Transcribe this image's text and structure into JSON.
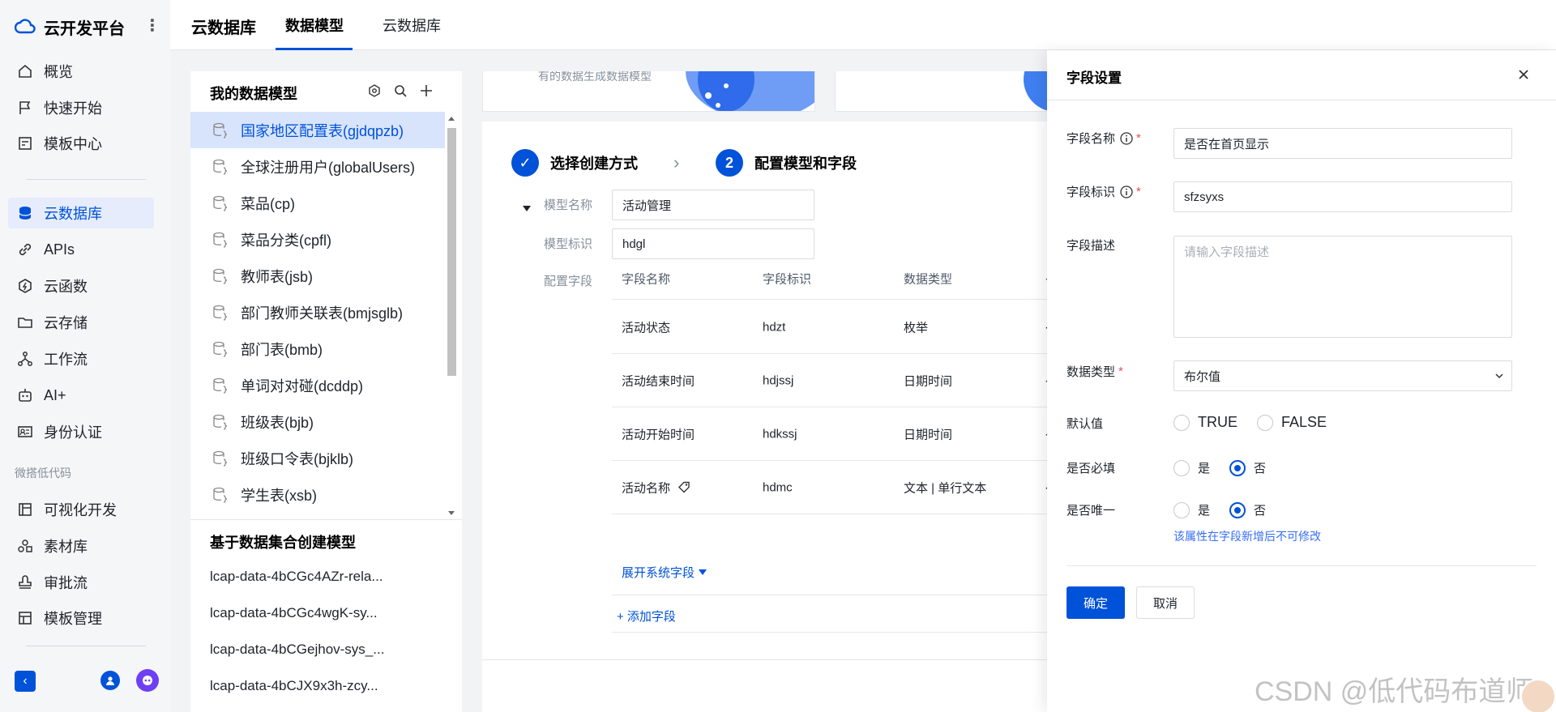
{
  "brand": {
    "title": "云开发平台",
    "more": "⋮"
  },
  "nav": {
    "items": [
      {
        "label": "概览",
        "icon": "home-icon"
      },
      {
        "label": "快速开始",
        "icon": "flag-icon"
      },
      {
        "label": "模板中心",
        "icon": "template-icon"
      },
      {
        "label": "云数据库",
        "icon": "database-icon",
        "active": true
      },
      {
        "label": "APIs",
        "icon": "link-icon"
      },
      {
        "label": "云函数",
        "icon": "function-icon"
      },
      {
        "label": "云存储",
        "icon": "folder-icon"
      },
      {
        "label": "工作流",
        "icon": "workflow-icon"
      },
      {
        "label": "AI+",
        "icon": "robot-icon"
      },
      {
        "label": "身份认证",
        "icon": "id-card-icon"
      },
      {
        "label": "可视化开发",
        "icon": "layout-icon"
      },
      {
        "label": "素材库",
        "icon": "assets-icon"
      },
      {
        "label": "审批流",
        "icon": "stamp-icon"
      },
      {
        "label": "模板管理",
        "icon": "template-manage-icon"
      }
    ],
    "group_label": "微搭低代码",
    "collapse_icon": "‹"
  },
  "topbar": {
    "title": "云数据库",
    "tabs": [
      "数据模型",
      "云数据库"
    ]
  },
  "model_panel": {
    "title": "我的数据模型",
    "items": [
      "国家地区配置表(gjdqpzb)",
      "全球注册用户(globalUsers)",
      "菜品(cp)",
      "菜品分类(cpfl)",
      "教师表(jsb)",
      "部门教师关联表(bmjsglb)",
      "部门表(bmb)",
      "单词对对碰(dcddp)",
      "班级表(bjb)",
      "班级口令表(bjklb)",
      "学生表(xsb)"
    ],
    "dataset_title": "基于数据集合创建模型",
    "datasets": [
      "lcap-data-4bCGc4AZr-rela...",
      "lcap-data-4bCGc4wgK-sy...",
      "lcap-data-4bCGejhov-sys_...",
      "lcap-data-4bCJX9x3h-zcy..."
    ]
  },
  "banner": {
    "text": "有的数据生成数据模型"
  },
  "steps": [
    {
      "num": "✓",
      "label": "选择创建方式"
    },
    {
      "num": "2",
      "label": "配置模型和字段"
    }
  ],
  "model_form": {
    "name_label": "模型名称",
    "name_value": "活动管理",
    "id_label": "模型标识",
    "id_value": "hdgl",
    "fields_label": "配置字段"
  },
  "field_table": {
    "headers": [
      "字段名称",
      "字段标识",
      "数据类型",
      "·"
    ],
    "rows": [
      [
        "活动状态",
        "hdzt",
        "枚举",
        "·"
      ],
      [
        "活动结束时间",
        "hdjssj",
        "日期时间",
        "·"
      ],
      [
        "活动开始时间",
        "hdkssj",
        "日期时间",
        "·"
      ],
      [
        "活动名称",
        "hdmc",
        "文本 | 单行文本",
        "·"
      ]
    ],
    "expand_label": "展开系统字段",
    "add_label": "+ 添加字段"
  },
  "drawer": {
    "title": "字段设置",
    "field_name_label": "字段名称",
    "field_name_value": "是否在首页显示",
    "field_id_label": "字段标识",
    "field_id_value": "sfzsyxs",
    "desc_label": "字段描述",
    "desc_placeholder": "请输入字段描述",
    "type_label": "数据类型",
    "type_value": "布尔值",
    "default_label": "默认值",
    "default_true": "TRUE",
    "default_false": "FALSE",
    "required_label": "是否必填",
    "unique_label": "是否唯一",
    "yes": "是",
    "no": "否",
    "required_asterisk": "*",
    "unique_hint": "该属性在字段新增后不可修改",
    "ok": "确定",
    "cancel": "取消"
  },
  "watermark": "CSDN @低代码布道师",
  "colors": {
    "primary": "#0052d9",
    "active_bg": "#d8e4fb",
    "required": "#e34d59"
  }
}
